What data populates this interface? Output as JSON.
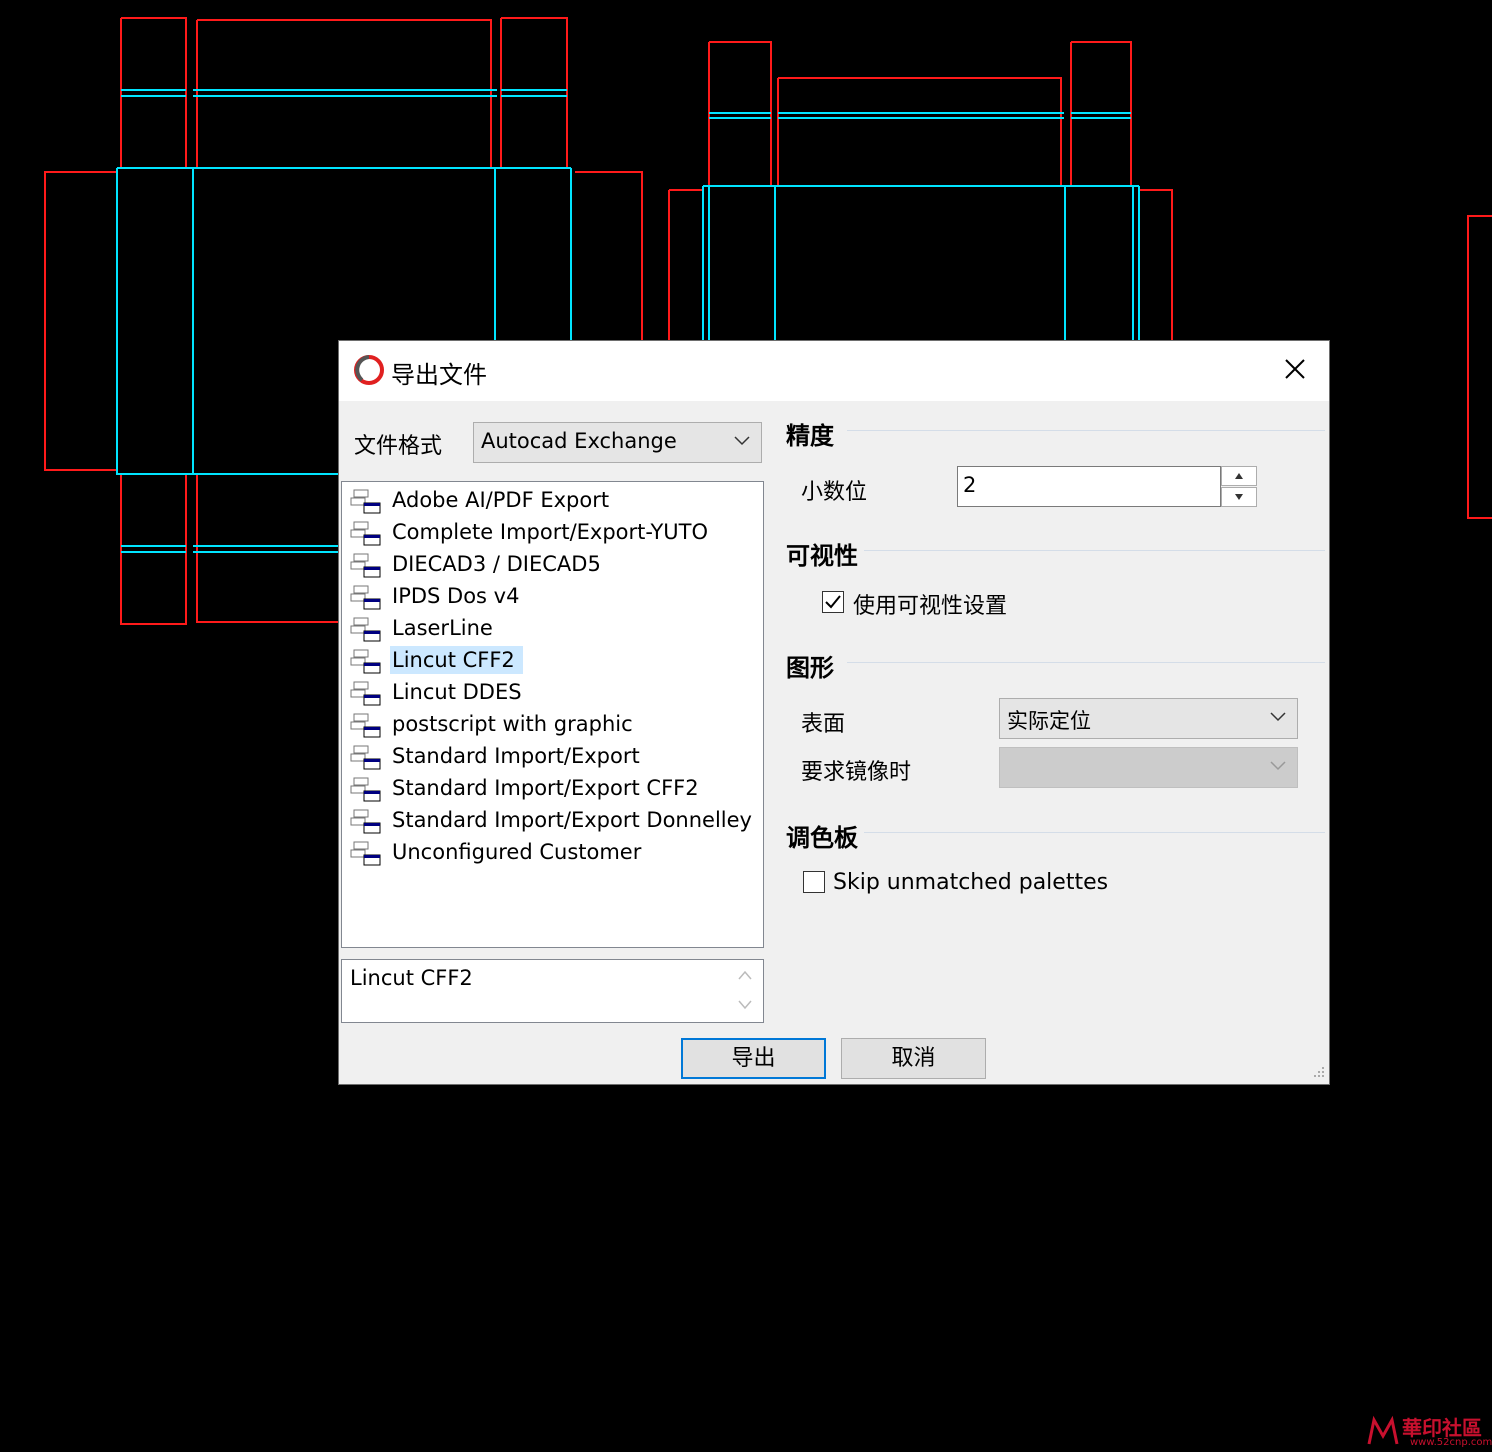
{
  "dialog": {
    "title": "导出文件",
    "close_glyph": "✕",
    "format_label": "文件格式",
    "format_value": "Autocad Exchange",
    "formats": [
      "Adobe AI/PDF Export",
      "Complete Import/Export-YUTO",
      "DIECAD3 / DIECAD5",
      "IPDS Dos v4",
      "LaserLine",
      "Lincut CFF2",
      "Lincut DDES",
      "postscript with graphic",
      "Standard Import/Export",
      "Standard Import/Export CFF2",
      "Standard Import/Export Donnelley",
      "Unconfigured Customer"
    ],
    "selected_format": "Lincut CFF2",
    "description": "Lincut CFF2",
    "precision": {
      "heading": "精度",
      "decimals_label": "小数位",
      "decimals_value": "2"
    },
    "visibility": {
      "heading": "可视性",
      "use_visibility_label": "使用可视性设置",
      "use_visibility_checked": true
    },
    "graphics": {
      "heading": "图形",
      "surface_label": "表面",
      "surface_value": "实际定位",
      "mirror_label": "要求镜像时",
      "mirror_value": ""
    },
    "palette": {
      "heading": "调色板",
      "skip_label": "Skip unmatched palettes",
      "skip_checked": false
    },
    "export_button": "导出",
    "cancel_button": "取消"
  },
  "watermark": {
    "name": "華印社區",
    "url": "www.52cnp.com"
  },
  "colors": {
    "background": "#000000",
    "cut_line": "#ff0000",
    "crease_line": "#00e5ff",
    "dialog_bg": "#f0f0f0",
    "selection": "#cce8ff",
    "accent": "#0078d7"
  }
}
